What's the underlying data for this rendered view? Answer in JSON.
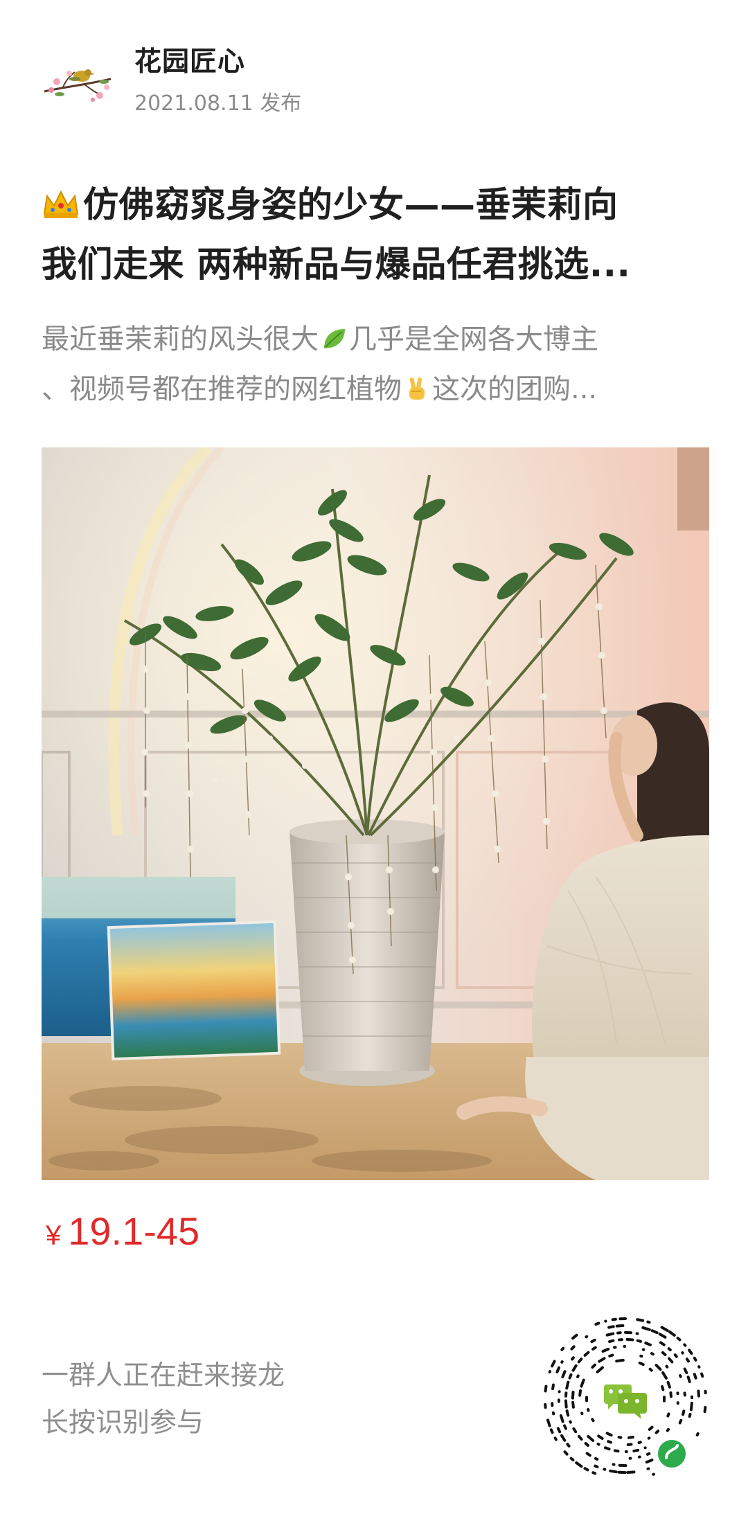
{
  "author": {
    "name": "花园匠心",
    "publish_date": "2021.08.11 发布"
  },
  "title": {
    "line1": "仿佛窈窕身姿的少女——垂茉莉向",
    "line2": "我们走来 两种新品与爆品任君挑选..."
  },
  "summary": {
    "part1": "最近垂茉莉的风头很大",
    "part2": "几乎是全网各大博主",
    "part3": "、视频号都在推荐的网红植物",
    "part4": "这次的团购..."
  },
  "price": {
    "currency": "¥",
    "range": "19.1-45"
  },
  "footer": {
    "line1": "一群人正在赶来接龙",
    "line2": "长按识别参与"
  },
  "icons": {
    "crown": "crown-icon",
    "leaf": "leaf-icon",
    "victory": "victory-hand-icon",
    "mini_program": "mini-program-icon"
  },
  "colors": {
    "price": "#e02a2a",
    "muted_text": "#8a8a8a",
    "title_text": "#202020"
  }
}
